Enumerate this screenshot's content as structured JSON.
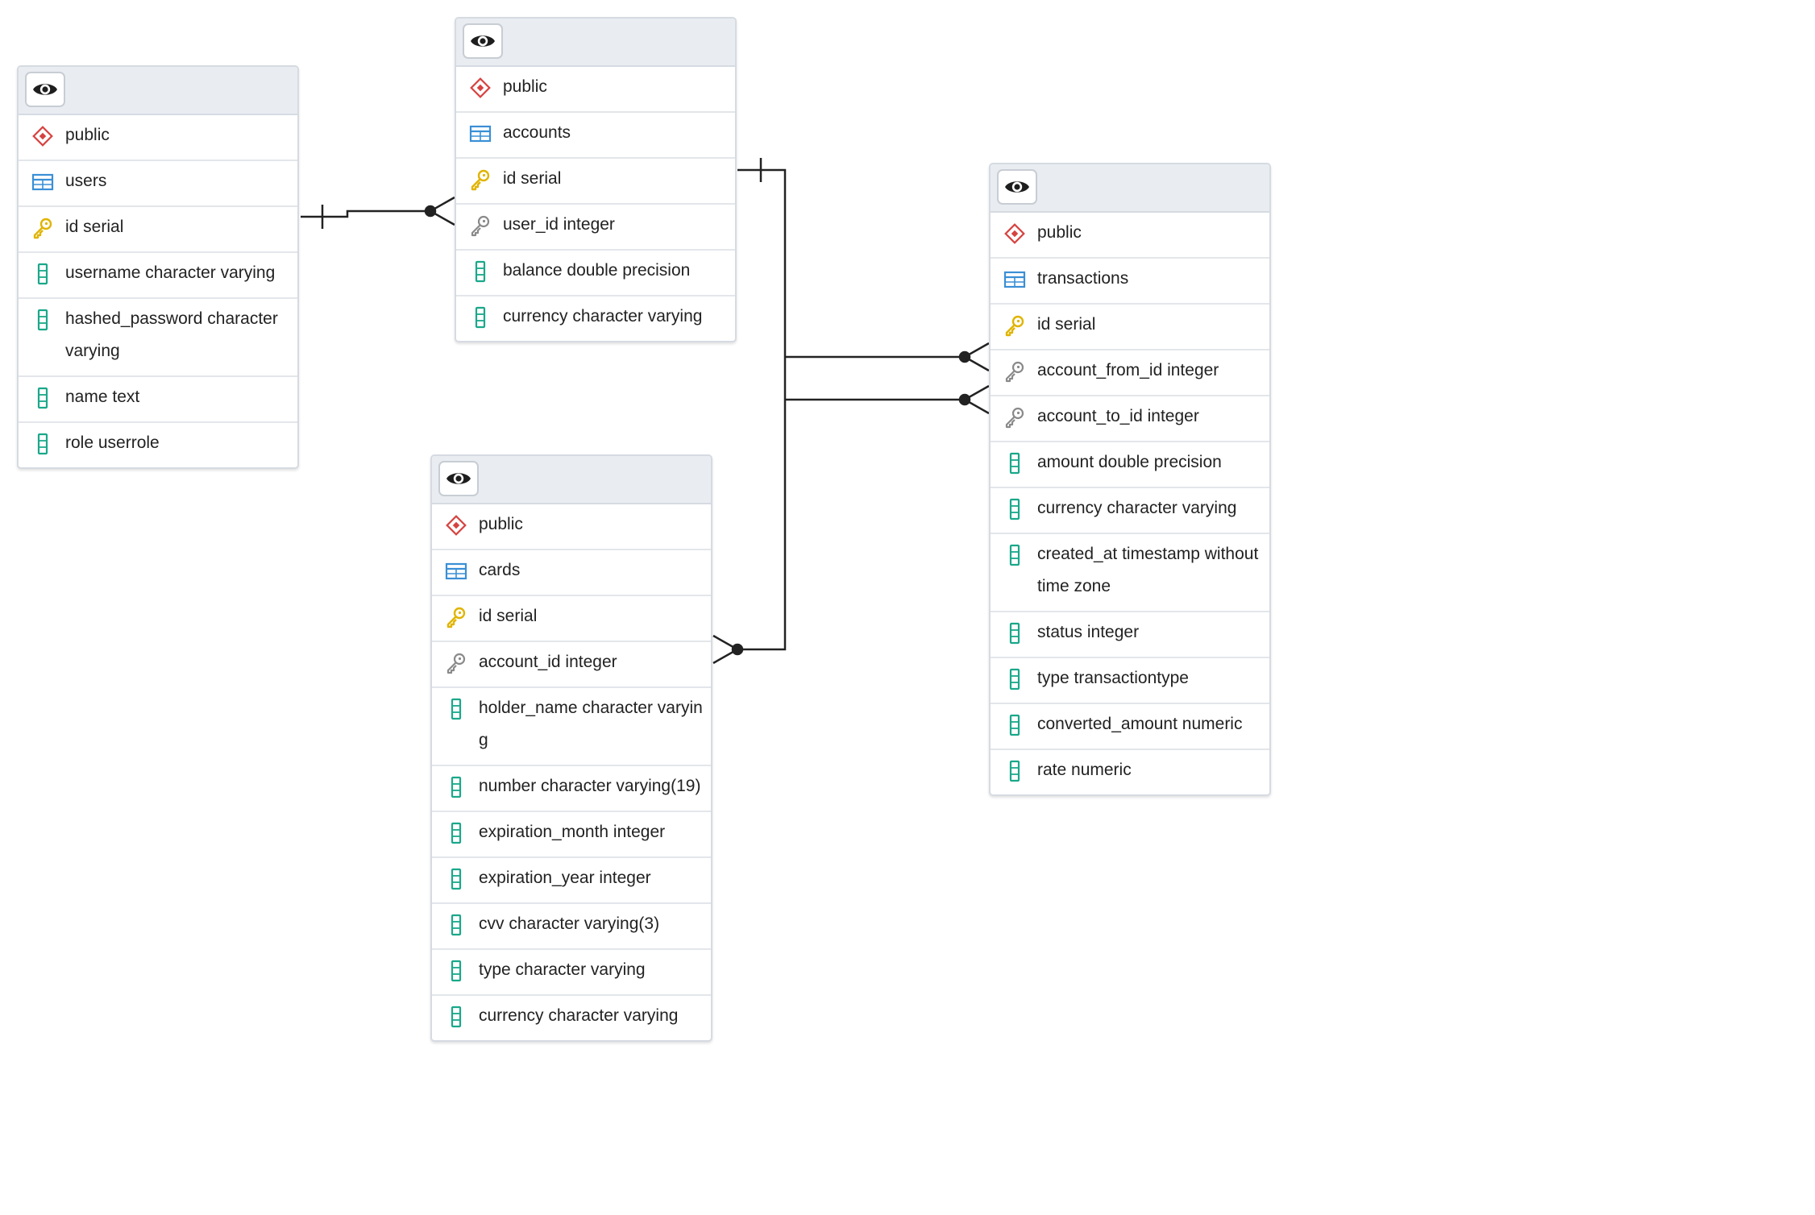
{
  "colors": {
    "schema_icon": "#d6423f",
    "table_icon": "#3a8fd6",
    "pk_icon": "#e0b400",
    "fk_icon": "#8a8a8a",
    "column_icon": "#1aa88a",
    "header_bg": "#e9edf2",
    "border": "#d6dbe2",
    "link": "#222222"
  },
  "tables": [
    {
      "id": "users",
      "rows": [
        {
          "icon": "schema-icon",
          "text": "public"
        },
        {
          "icon": "table-icon",
          "text": "users"
        },
        {
          "icon": "primary-key-icon",
          "text": "id serial"
        },
        {
          "icon": "column-icon",
          "text": "username character varying"
        },
        {
          "icon": "column-icon",
          "text": "hashed_password character varying"
        },
        {
          "icon": "column-icon",
          "text": "name text"
        },
        {
          "icon": "column-icon",
          "text": "role userrole"
        }
      ]
    },
    {
      "id": "accounts",
      "rows": [
        {
          "icon": "schema-icon",
          "text": "public"
        },
        {
          "icon": "table-icon",
          "text": "accounts"
        },
        {
          "icon": "primary-key-icon",
          "text": "id serial"
        },
        {
          "icon": "foreign-key-icon",
          "text": "user_id integer"
        },
        {
          "icon": "column-icon",
          "text": "balance double precision"
        },
        {
          "icon": "column-icon",
          "text": "currency character varying"
        }
      ]
    },
    {
      "id": "transactions",
      "rows": [
        {
          "icon": "schema-icon",
          "text": "public"
        },
        {
          "icon": "table-icon",
          "text": "transactions"
        },
        {
          "icon": "primary-key-icon",
          "text": "id serial"
        },
        {
          "icon": "foreign-key-icon",
          "text": "account_from_id integer"
        },
        {
          "icon": "foreign-key-icon",
          "text": "account_to_id integer"
        },
        {
          "icon": "column-icon",
          "text": "amount double precision"
        },
        {
          "icon": "column-icon",
          "text": "currency character varying"
        },
        {
          "icon": "column-icon",
          "text": "created_at timestamp without time zone"
        },
        {
          "icon": "column-icon",
          "text": "status integer"
        },
        {
          "icon": "column-icon",
          "text": "type transactiontype"
        },
        {
          "icon": "column-icon",
          "text": "converted_amount numeric"
        },
        {
          "icon": "column-icon",
          "text": "rate numeric"
        }
      ]
    },
    {
      "id": "cards",
      "rows": [
        {
          "icon": "schema-icon",
          "text": "public"
        },
        {
          "icon": "table-icon",
          "text": "cards"
        },
        {
          "icon": "primary-key-icon",
          "text": "id serial"
        },
        {
          "icon": "foreign-key-icon",
          "text": "account_id integer"
        },
        {
          "icon": "column-icon",
          "text": "holder_name character varying"
        },
        {
          "icon": "column-icon",
          "text": "number character varying(19)"
        },
        {
          "icon": "column-icon",
          "text": "expiration_month integer"
        },
        {
          "icon": "column-icon",
          "text": "expiration_year integer"
        },
        {
          "icon": "column-icon",
          "text": "cvv character varying(3)"
        },
        {
          "icon": "column-icon",
          "text": "type character varying"
        },
        {
          "icon": "column-icon",
          "text": "currency character varying"
        }
      ]
    }
  ],
  "relationships": [
    {
      "from": "users.id",
      "to": "accounts.user_id",
      "cardinality": "one-to-many"
    },
    {
      "from": "accounts.id",
      "to": "transactions.account_from_id",
      "cardinality": "one-to-many"
    },
    {
      "from": "accounts.id",
      "to": "transactions.account_to_id",
      "cardinality": "one-to-many"
    },
    {
      "from": "accounts.id",
      "to": "cards.account_id",
      "cardinality": "one-to-many"
    }
  ]
}
